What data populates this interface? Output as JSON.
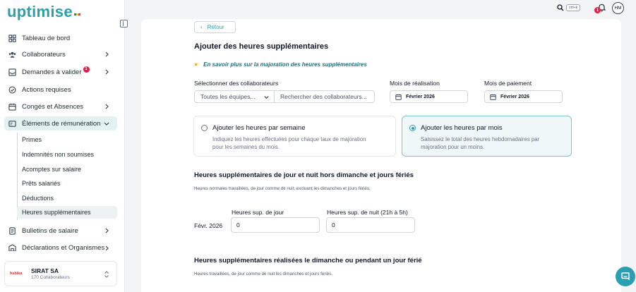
{
  "brand": {
    "name": "uptimise",
    "accent": "#2b9fb0"
  },
  "topbar": {
    "shortcut": "ctrl+k",
    "notifications": "1",
    "avatar_initials": "HM"
  },
  "sidebar": {
    "items": [
      {
        "label": "Tableau de bord",
        "icon": "grid-icon"
      },
      {
        "label": "Collaborateurs",
        "icon": "users-icon"
      },
      {
        "label": "Demandes à valider",
        "icon": "inbox-icon",
        "badge": "1"
      },
      {
        "label": "Actions requises",
        "icon": "check-circle-icon"
      },
      {
        "label": "Congés et Absences",
        "icon": "calendar-icon"
      },
      {
        "label": "Éléments de rémunération",
        "icon": "card-icon"
      },
      {
        "label": "Bulletins de salaire",
        "icon": "document-icon"
      },
      {
        "label": "Déclarations et Organismes",
        "icon": "building-icon"
      }
    ],
    "sub_items": [
      "Primes",
      "Indemnités non soumises",
      "Acomptes sur salaire",
      "Prêts salariés",
      "Déductions",
      "Heures supplémentaires"
    ],
    "company": {
      "logo_text": "hsbika",
      "name": "SIRAT SA",
      "count": "170 Collaborateurs"
    }
  },
  "main": {
    "back_label": "Retour",
    "title": "Ajouter des heures supplémentaires",
    "learn_more": "En savoir plus sur la majoration des heures supplémentaires",
    "collab_label": "Sélectionner des collaborateurs",
    "team_select": "Toutes les équipes...",
    "collab_placeholder": "Rechercher des collaborateurs...",
    "realisation_label": "Mois de réalisation",
    "realisation_value": "Février 2026",
    "payment_label": "Mois de paiement",
    "payment_value": "Février 2026",
    "options": [
      {
        "title": "Ajouter les heures par semaine",
        "desc": "Indiquez les heures effectuées pour chaque taux de majoration pour les semaines du mois.",
        "selected": false
      },
      {
        "title": "Ajouter les heures par mois",
        "desc": "Saisissez le total des heures hebdomadaires par majoration pour un moins.",
        "selected": true
      }
    ],
    "section1": {
      "title": "Heures supplémentaires de jour et nuit hors dimanche et jours fériés",
      "desc": "Heures normales travaillées, de jour comme de nuit, excluant les dimanches et jours fériés.",
      "col_day": "Heures sup. de jour",
      "col_night": "Heures sup. de nuit (21h à 5h)",
      "row_label": "Févr. 2026",
      "day_value": "0",
      "night_value": "0"
    },
    "section2": {
      "title": "Heures supplémentaires réalisées le dimanche ou pendant un jour férié",
      "desc": "Heures travaillées, de jour comme de nuit les dimanches et jours fériés."
    }
  }
}
